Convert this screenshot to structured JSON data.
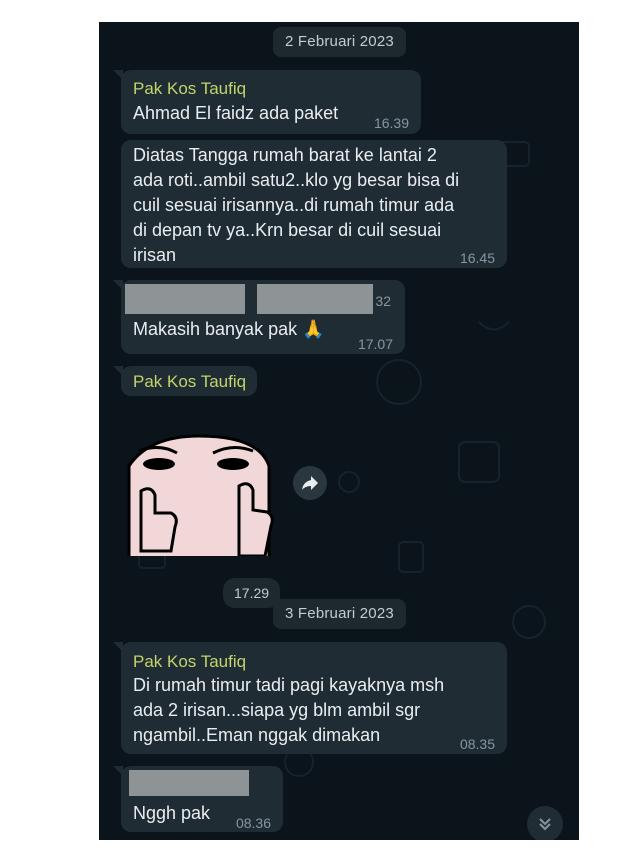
{
  "dates": [
    "2 Februari 2023",
    "3 Februari 2023"
  ],
  "messages": [
    {
      "sender": "Pak Kos Taufiq",
      "text": "Ahmad El faidz ada paket",
      "time": "16.39"
    },
    {
      "text": "Diatas Tangga rumah barat ke lantai 2\nada roti..ambil  satu2..klo yg besar bisa di\ncuil sesuai irisannya..di rumah timur ada\ndi depan tv ya..Krn besar di cuil sesuai\nirisan",
      "time": "16.45"
    },
    {
      "quoted_fragment": "32",
      "text": "Makasih banyak pak 🙏",
      "time": "17.07"
    },
    {
      "sender": "Pak Kos Taufiq",
      "sticker": "thumbs-up-peeking-character",
      "time": "17.29"
    },
    {
      "sender": "Pak Kos Taufiq",
      "text": "Di rumah timur tadi pagi kayaknya msh\nada 2 irisan...siapa yg blm ambil sgr\nngambil..Eman nggak dimakan",
      "time": "08.35"
    },
    {
      "text": "Nggh pak",
      "time": "08.36"
    }
  ],
  "icons": {
    "forward": "forward-icon",
    "scroll": "chevron-double-down-icon"
  },
  "colors": {
    "background": "#0b141a",
    "bubble": "#1f2c34",
    "sender_name": "#c2d46a",
    "text": "#e9edef",
    "timestamp": "#8696a0",
    "redaction": "#8e9396"
  }
}
